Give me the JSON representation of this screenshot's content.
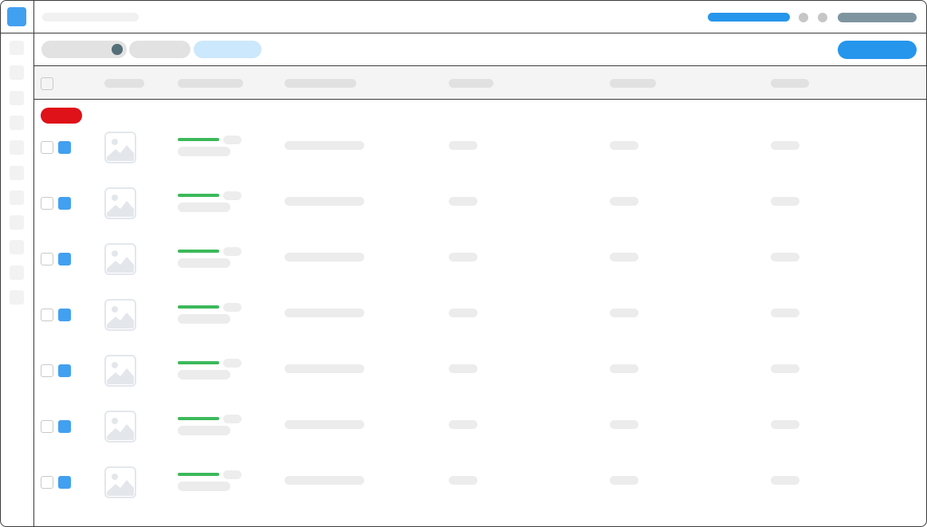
{
  "app": {
    "accent": "#42a0f0"
  },
  "topbar": {
    "title": "",
    "link_label": "",
    "user_label": ""
  },
  "sidebar": {
    "item_count": 11
  },
  "toolbar": {
    "filters": [
      "",
      "",
      ""
    ],
    "primary_action_label": ""
  },
  "table": {
    "columns": [
      "",
      "",
      "",
      "",
      "",
      ""
    ],
    "group_badge": "",
    "rows": [
      {
        "name": "",
        "meta": "",
        "desc": "",
        "c1": "",
        "c2": "",
        "c3": ""
      },
      {
        "name": "",
        "meta": "",
        "desc": "",
        "c1": "",
        "c2": "",
        "c3": ""
      },
      {
        "name": "",
        "meta": "",
        "desc": "",
        "c1": "",
        "c2": "",
        "c3": ""
      },
      {
        "name": "",
        "meta": "",
        "desc": "",
        "c1": "",
        "c2": "",
        "c3": ""
      },
      {
        "name": "",
        "meta": "",
        "desc": "",
        "c1": "",
        "c2": "",
        "c3": ""
      },
      {
        "name": "",
        "meta": "",
        "desc": "",
        "c1": "",
        "c2": "",
        "c3": ""
      },
      {
        "name": "",
        "meta": "",
        "desc": "",
        "c1": "",
        "c2": "",
        "c3": ""
      }
    ]
  },
  "colors": {
    "primary": "#2596ec",
    "status_ok": "#3cb95a",
    "danger": "#df1119",
    "skeleton": "#ececec"
  },
  "icons": {
    "thumbnail": "image-placeholder-icon"
  }
}
